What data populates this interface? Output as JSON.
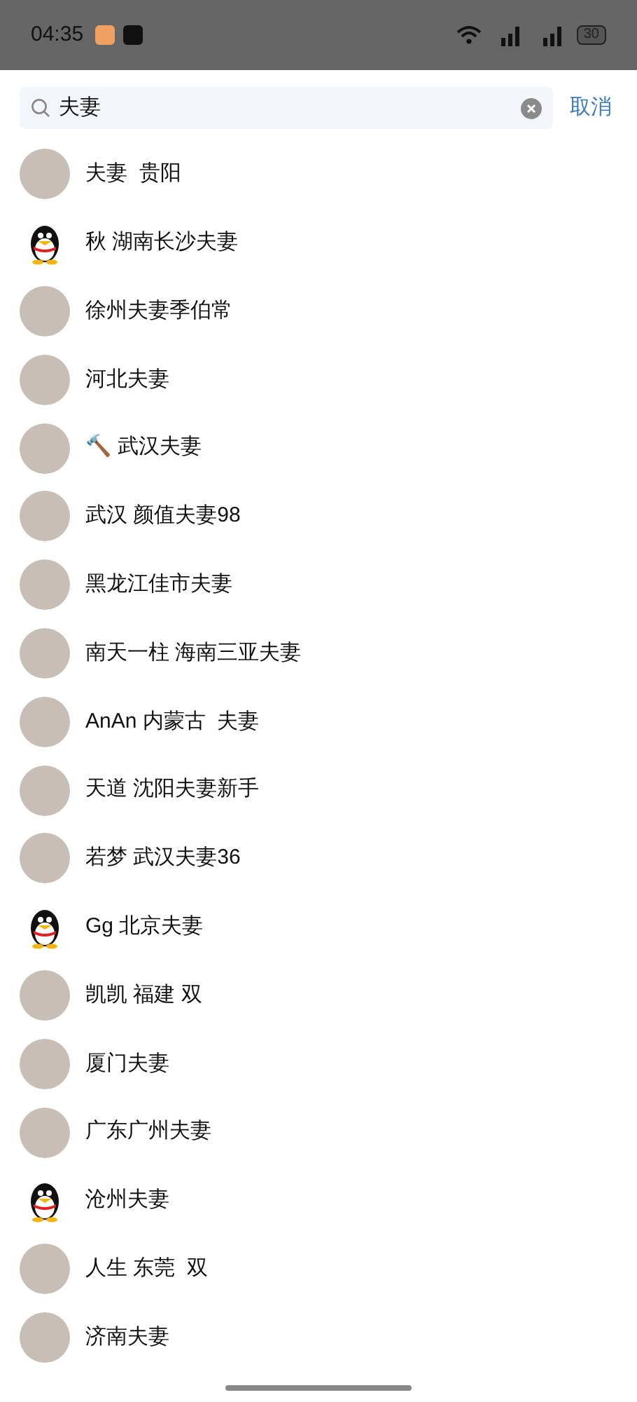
{
  "status_bar": {
    "time": "04:35",
    "battery": "30"
  },
  "search": {
    "value": "夫妻",
    "cancel": "取消"
  },
  "results": [
    {
      "name": "夫妻  贵阳",
      "kind": "photo"
    },
    {
      "name": "秋 湖南长沙夫妻",
      "kind": "penguin"
    },
    {
      "name": "徐州夫妻季伯常",
      "kind": "photo"
    },
    {
      "name": "河北夫妻",
      "kind": "photo"
    },
    {
      "name": "🔨 武汉夫妻",
      "kind": "photo"
    },
    {
      "name": "武汉 颜值夫妻98",
      "kind": "photo"
    },
    {
      "name": "黑龙江佳市夫妻",
      "kind": "photo"
    },
    {
      "name": "南天一柱 海南三亚夫妻",
      "kind": "photo"
    },
    {
      "name": "AnAn 内蒙古  夫妻",
      "kind": "photo"
    },
    {
      "name": "天道 沈阳夫妻新手",
      "kind": "photo"
    },
    {
      "name": "若梦 武汉夫妻36",
      "kind": "photo"
    },
    {
      "name": "Gg 北京夫妻",
      "kind": "penguin"
    },
    {
      "name": "凯凯 福建 双",
      "kind": "photo"
    },
    {
      "name": "厦门夫妻",
      "kind": "photo"
    },
    {
      "name": "广东广州夫妻",
      "kind": "photo"
    },
    {
      "name": "沧州夫妻",
      "kind": "penguin"
    },
    {
      "name": "人生 东莞  双",
      "kind": "photo"
    },
    {
      "name": "济南夫妻",
      "kind": "photo"
    }
  ]
}
